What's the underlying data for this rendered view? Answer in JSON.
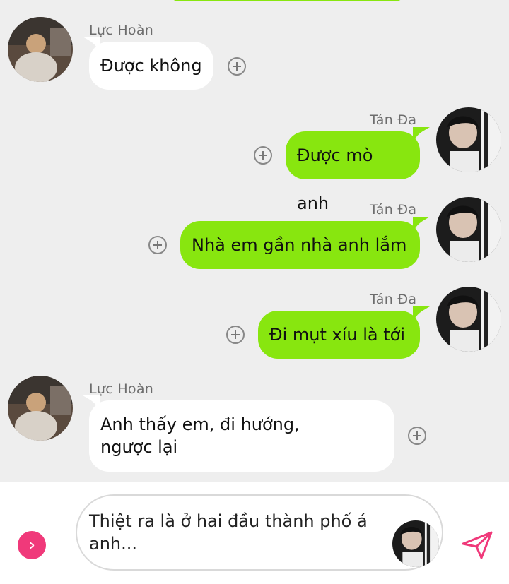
{
  "messages": [
    {
      "sender": "Lực Hoàn",
      "text": "Được không",
      "direction": "incoming"
    },
    {
      "sender": "Tán Đa",
      "text": "Được mò anh",
      "direction": "outgoing"
    },
    {
      "sender": "Tán Đa",
      "text": "Nhà em gần nhà anh lắm",
      "direction": "outgoing"
    },
    {
      "sender": "Tán Đa",
      "text": "Đi mụt xíu là tới",
      "direction": "outgoing"
    },
    {
      "sender": "Lực Hoàn",
      "text_line1": "Anh thấy em, đi hướng,",
      "text_line2": "ngược lại",
      "direction": "incoming"
    }
  ],
  "composer": {
    "text_line1": "Thiệt ra là ở hai đầu thành phố á",
    "text_line2": "anh...",
    "expand_icon": "chevron-right-icon",
    "send_icon": "send-icon"
  },
  "colors": {
    "outgoing_bubble": "#88e60f",
    "incoming_bubble": "#ffffff",
    "background": "#eeeeee",
    "accent": "#f0397a"
  }
}
